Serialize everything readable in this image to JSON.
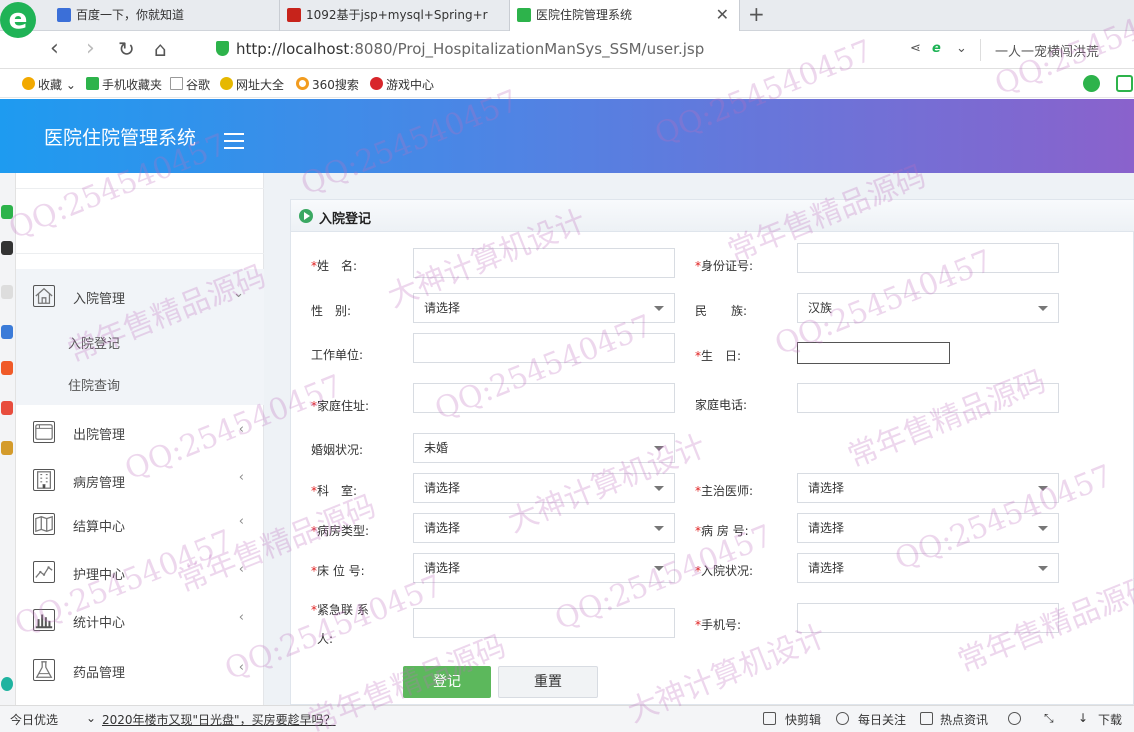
{
  "browser": {
    "logo_text": "e",
    "tabs": [
      {
        "title": "百度一下，你就知道",
        "color": "#3b6fd8"
      },
      {
        "title": "1092基于jsp+mysql+Spring+r",
        "color": "#c7231b"
      },
      {
        "title": "医院住院管理系统",
        "color": "#2db34b",
        "close": "✕"
      }
    ],
    "new_tab": "+",
    "url_host": "http://localhost",
    "url_rest": ":8080/Proj_HospitalizationManSys_SSM/user.jsp",
    "right_text": "一人一宠横闯洪荒",
    "bookmarks": [
      {
        "label": "收藏",
        "color": "#f2a900"
      },
      {
        "label": "手机收藏夹",
        "color": "#2db34b"
      },
      {
        "label": "谷歌",
        "color": "#999999"
      },
      {
        "label": "网址大全",
        "color": "#e6b800"
      },
      {
        "label": "360搜索",
        "color": "#f29c1f"
      },
      {
        "label": "游戏中心",
        "color": "#d8262b"
      }
    ]
  },
  "app": {
    "title": "医院住院管理系统",
    "sidebar": {
      "items": [
        {
          "label": "入院管理",
          "arrow": "⌄"
        },
        {
          "label": "出院管理",
          "arrow": "‹"
        },
        {
          "label": "病房管理",
          "arrow": "‹"
        },
        {
          "label": "结算中心",
          "arrow": "‹"
        },
        {
          "label": "护理中心",
          "arrow": "‹"
        },
        {
          "label": "统计中心",
          "arrow": "‹"
        },
        {
          "label": "药品管理",
          "arrow": "‹"
        }
      ],
      "subitems": [
        "入院登记",
        "住院查询"
      ]
    },
    "form": {
      "heading": "入院登记",
      "required_mark": "*",
      "name_label": "姓　名:",
      "idcard_label": "身份证号:",
      "gender_label": "性　别:",
      "gender_value": "请选择",
      "ethnicity_label": "民　　族:",
      "ethnicity_value": "汉族",
      "employer_label": "工作单位:",
      "birthday_label": "生　日:",
      "address_label": "家庭住址:",
      "phone_label": "家庭电话:",
      "marital_label": "婚姻状况:",
      "marital_value": "未婚",
      "department_label": "科　室:",
      "department_value": "请选择",
      "doctor_label": "主治医师:",
      "doctor_value": "请选择",
      "wardtype_label": "病房类型:",
      "wardtype_value": "请选择",
      "wardno_label": "病 房 号:",
      "wardno_value": "请选择",
      "bedno_label": "床 位 号:",
      "bedno_value": "请选择",
      "status_label": "入院状况:",
      "status_value": "请选择",
      "emergency_label_1": "紧急联 系",
      "emergency_label_2": "人:",
      "mobile_label": "手机号:",
      "submit": "登记",
      "reset": "重置"
    }
  },
  "statusbar": {
    "left": "今日优选",
    "news": "2020年楼市又现\"日光盘\"，买房要趁早吗？",
    "items": [
      "快剪辑",
      "每日关注",
      "热点资讯",
      "下载"
    ]
  },
  "watermarks": [
    "QQ:254540457",
    "常年售精品源码",
    "大神计算机设计"
  ]
}
